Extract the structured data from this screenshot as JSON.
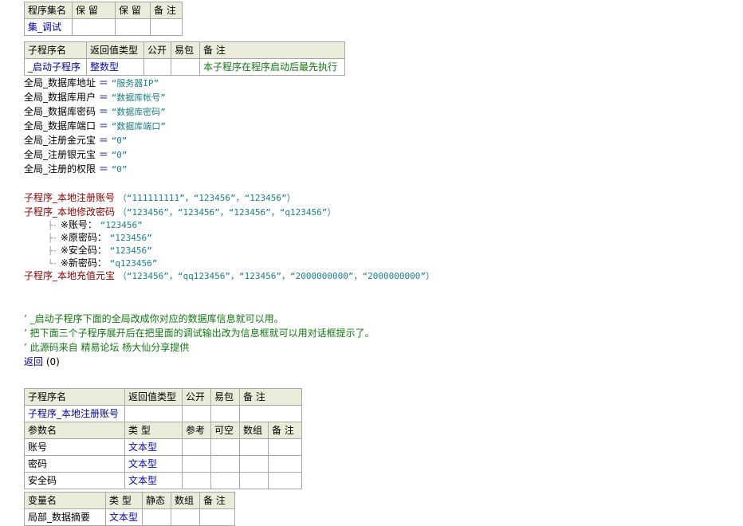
{
  "assembly_table": {
    "headers": [
      "程序集名",
      "保 留",
      "保 留",
      "备 注"
    ],
    "row": [
      "集_调试",
      "",
      "",
      ""
    ]
  },
  "sub1_table": {
    "headers": [
      "子程序名",
      "返回值类型",
      "公开",
      "易包",
      "备 注"
    ],
    "row": [
      "_启动子程序",
      "整数型",
      "",
      "",
      "本子程序在程序启动后最先执行"
    ]
  },
  "assignments": [
    {
      "name": "全局_数据库地址",
      "op": "＝",
      "value": "“服务器IP”"
    },
    {
      "name": "全局_数据库用户",
      "op": "＝",
      "value": "“数据库帐号”"
    },
    {
      "name": "全局_数据库密码",
      "op": "＝",
      "value": "“数据库密码”"
    },
    {
      "name": "全局_数据库端口",
      "op": "＝",
      "value": "“数据库端口”"
    },
    {
      "name": "全局_注册金元宝",
      "op": "＝",
      "value": "“0”"
    },
    {
      "name": "全局_注册银元宝",
      "op": "＝",
      "value": "“0”"
    },
    {
      "name": "全局_注册的权限",
      "op": "＝",
      "value": "“0”"
    }
  ],
  "calls": {
    "register": {
      "name": "子程序_本地注册账号",
      "args": "（“111111111”，“123456”，“123456”）"
    },
    "modify": {
      "name": "子程序_本地修改密码",
      "args": "（“123456”，“123456”，“123456”，“q123456”）"
    },
    "recharge": {
      "name": "子程序_本地充值元宝",
      "args": "（“123456”，“qq123456”，“123456”，“2000000000”，“2000000000”）"
    }
  },
  "modify_params": [
    {
      "label": "※账号：",
      "value": "“123456”"
    },
    {
      "label": "※原密码：",
      "value": "“123456”"
    },
    {
      "label": "※安全码：",
      "value": "“123456”"
    },
    {
      "label": "※新密码：",
      "value": "“q123456”"
    }
  ],
  "comments": [
    "’ _启动子程序下面的全局改成你对应的数据库信息就可以用。",
    "’ 把下面三个子程序展开后在把里面的调试输出改为信息框就可以用对话框提示了。",
    "’ 此源码来自 精易论坛  杨大仙分享提供"
  ],
  "return_stmt": {
    "keyword": "返回",
    "arg": "(0)"
  },
  "sub2_table": {
    "headers": [
      "子程序名",
      "返回值类型",
      "公开",
      "易包",
      "备 注"
    ],
    "row": [
      "子程序_本地注册账号",
      "",
      "",
      "",
      ""
    ],
    "param_headers": [
      "参数名",
      "类 型",
      "参考",
      "可空",
      "数组",
      "备 注"
    ],
    "params": [
      [
        "账号",
        "文本型",
        "",
        "",
        "",
        ""
      ],
      [
        "密码",
        "文本型",
        "",
        "",
        "",
        ""
      ],
      [
        "安全码",
        "文本型",
        "",
        "",
        "",
        ""
      ]
    ]
  },
  "var_table": {
    "headers": [
      "变量名",
      "类 型",
      "静态",
      "数组",
      "备 注"
    ],
    "rows": [
      [
        "局部_数据摘要",
        "文本型",
        "",
        "",
        ""
      ]
    ]
  }
}
